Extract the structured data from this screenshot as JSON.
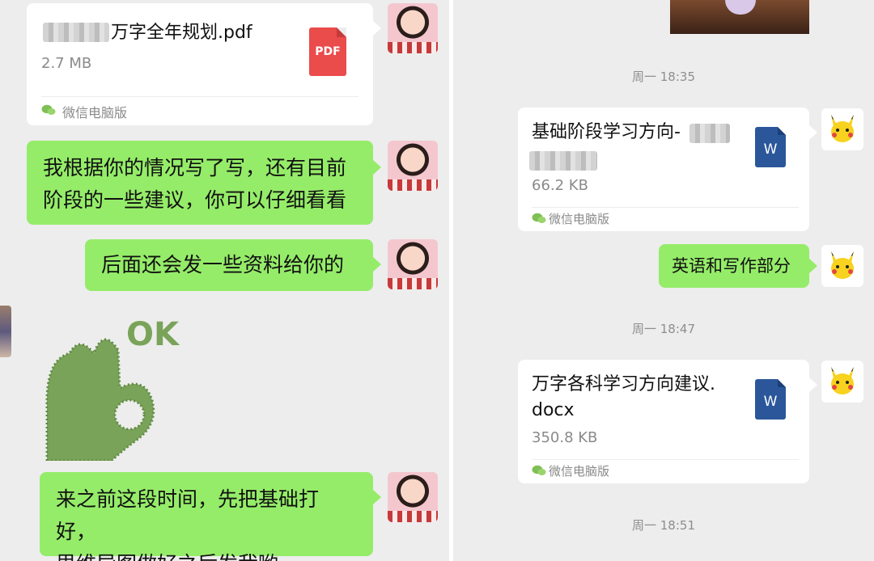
{
  "left": {
    "file_card": {
      "name": "万字全年规划.pdf",
      "size": "2.7 MB",
      "type_label": "PDF",
      "source": "微信电脑版",
      "icon": "pdf-file-icon"
    },
    "messages": [
      {
        "lines": [
          "我根据你的情况写了写，还有目前",
          "阶段的一些建议，你可以仔细看看"
        ]
      },
      {
        "lines": [
          "后面还会发一些资料给你的"
        ]
      },
      {
        "lines": [
          "来之前这段时间，先把基础打好，",
          "思维导图做好之后发我哟~"
        ]
      }
    ],
    "sticker": {
      "text": "OK",
      "icon": "ok-hand-sticker"
    },
    "avatar_icon": "girl-avatar"
  },
  "right": {
    "timestamps": [
      "周一 18:35",
      "周一 18:47",
      "周一 18:51"
    ],
    "file_cards": [
      {
        "name": "基础阶段学习方向-",
        "size": "66.2 KB",
        "type_label": "W",
        "source": "微信电脑版",
        "icon": "word-file-icon"
      },
      {
        "name": "万字各科学习方向建议.docx",
        "name_lines": [
          "万字各科学习方向建议.",
          "docx"
        ],
        "size": "350.8 KB",
        "type_label": "W",
        "source": "微信电脑版",
        "icon": "word-file-icon"
      }
    ],
    "message": "英语和写作部分",
    "avatar_icon": "pikachu-avatar"
  },
  "colors": {
    "chat_background": "#ededed",
    "sent_bubble": "#95ec69",
    "file_card": "#ffffff",
    "pdf_red": "#ea4b4b",
    "word_blue": "#2b579a",
    "meta_gray": "#8a8a8a"
  }
}
